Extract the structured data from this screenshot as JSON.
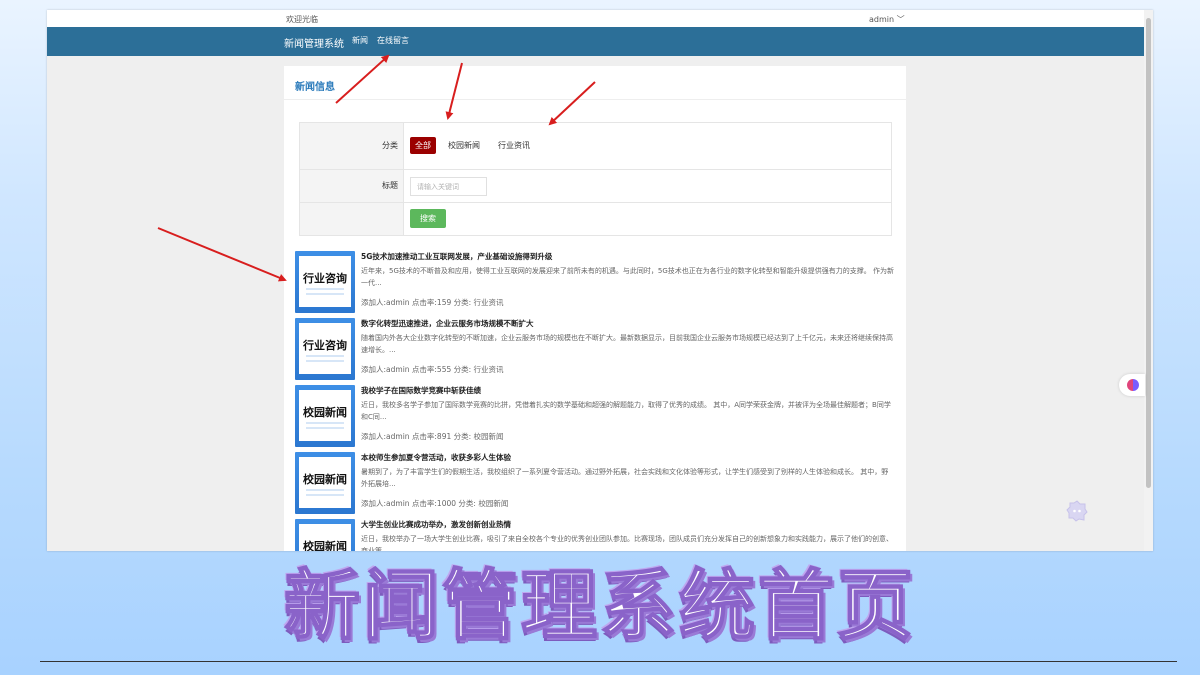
{
  "topbar": {
    "welcome": "欢迎光临",
    "admin": "admin ﹀"
  },
  "navbar": {
    "brand": "新闻管理系统",
    "items": [
      "新闻",
      "在线留言"
    ]
  },
  "panel": {
    "title": "新闻信息"
  },
  "filter": {
    "category_label": "分类",
    "categories": [
      {
        "label": "全部",
        "active": true
      },
      {
        "label": "校园新闻",
        "active": false
      },
      {
        "label": "行业资讯",
        "active": false
      }
    ],
    "title_label": "标题",
    "keyword_placeholder": "请输入关键词",
    "search_label": "搜索"
  },
  "news": [
    {
      "thumb_text": "行业咨询",
      "title": "5G技术加速推动工业互联网发展，产业基础设施得到升级",
      "summary": "近年来，5G技术的不断普及和应用，使得工业互联网的发展迎来了前所未有的机遇。与此同时，5G技术也正在为各行业的数字化转型和智能升级提供强有力的支撑。 作为新一代...",
      "meta": "添加人:admin  点击率:159  分类: 行业资讯"
    },
    {
      "thumb_text": "行业咨询",
      "title": "数字化转型迅速推进，企业云服务市场规模不断扩大",
      "summary": "随着国内外各大企业数字化转型的不断加速，企业云服务市场的规模也在不断扩大。最新数据显示，目前我国企业云服务市场规模已经达到了上千亿元，未来还将继续保持高速增长。...",
      "meta": "添加人:admin  点击率:555  分类: 行业资讯"
    },
    {
      "thumb_text": "校园新闻",
      "title": "我校学子在国际数学竞赛中斩获佳绩",
      "summary": "近日，我校多名学子参加了国际数学竞赛的比拼，凭借着扎实的数学基础和超强的解题能力，取得了优秀的成绩。 其中，A同学荣获金牌，并被评为全场最佳解题者；B同学和C同...",
      "meta": "添加人:admin  点击率:891  分类: 校园新闻"
    },
    {
      "thumb_text": "校园新闻",
      "title": "本校师生参加夏令营活动，收获多彩人生体验",
      "summary": "暑期到了，为了丰富学生们的假期生活，我校组织了一系列夏令营活动。通过野外拓展，社会实践和文化体验等形式，让学生们感受到了别样的人生体验和成长。 其中，野外拓展培...",
      "meta": "添加人:admin  点击率:1000  分类: 校园新闻"
    },
    {
      "thumb_text": "校园新闻",
      "title": "大学生创业比赛成功举办，激发创新创业热情",
      "summary": "近日，我校举办了一场大学生创业比赛，吸引了来自全校各个专业的优秀创业团队参加。比赛现场，团队成员们充分发挥自己的创新想象力和实践能力，展示了他们的创意、商业策...",
      "meta": ""
    }
  ],
  "caption": "新闻管理系统首页",
  "colors": {
    "navbar": "#2c6f98",
    "active_category": "#9b0000",
    "search_button": "#5cb85c",
    "arrow": "#d81e1e",
    "title_blue": "#2b7bbb"
  },
  "icons": {
    "plugin": "brain-icon",
    "assistant": "assistant-icon"
  }
}
